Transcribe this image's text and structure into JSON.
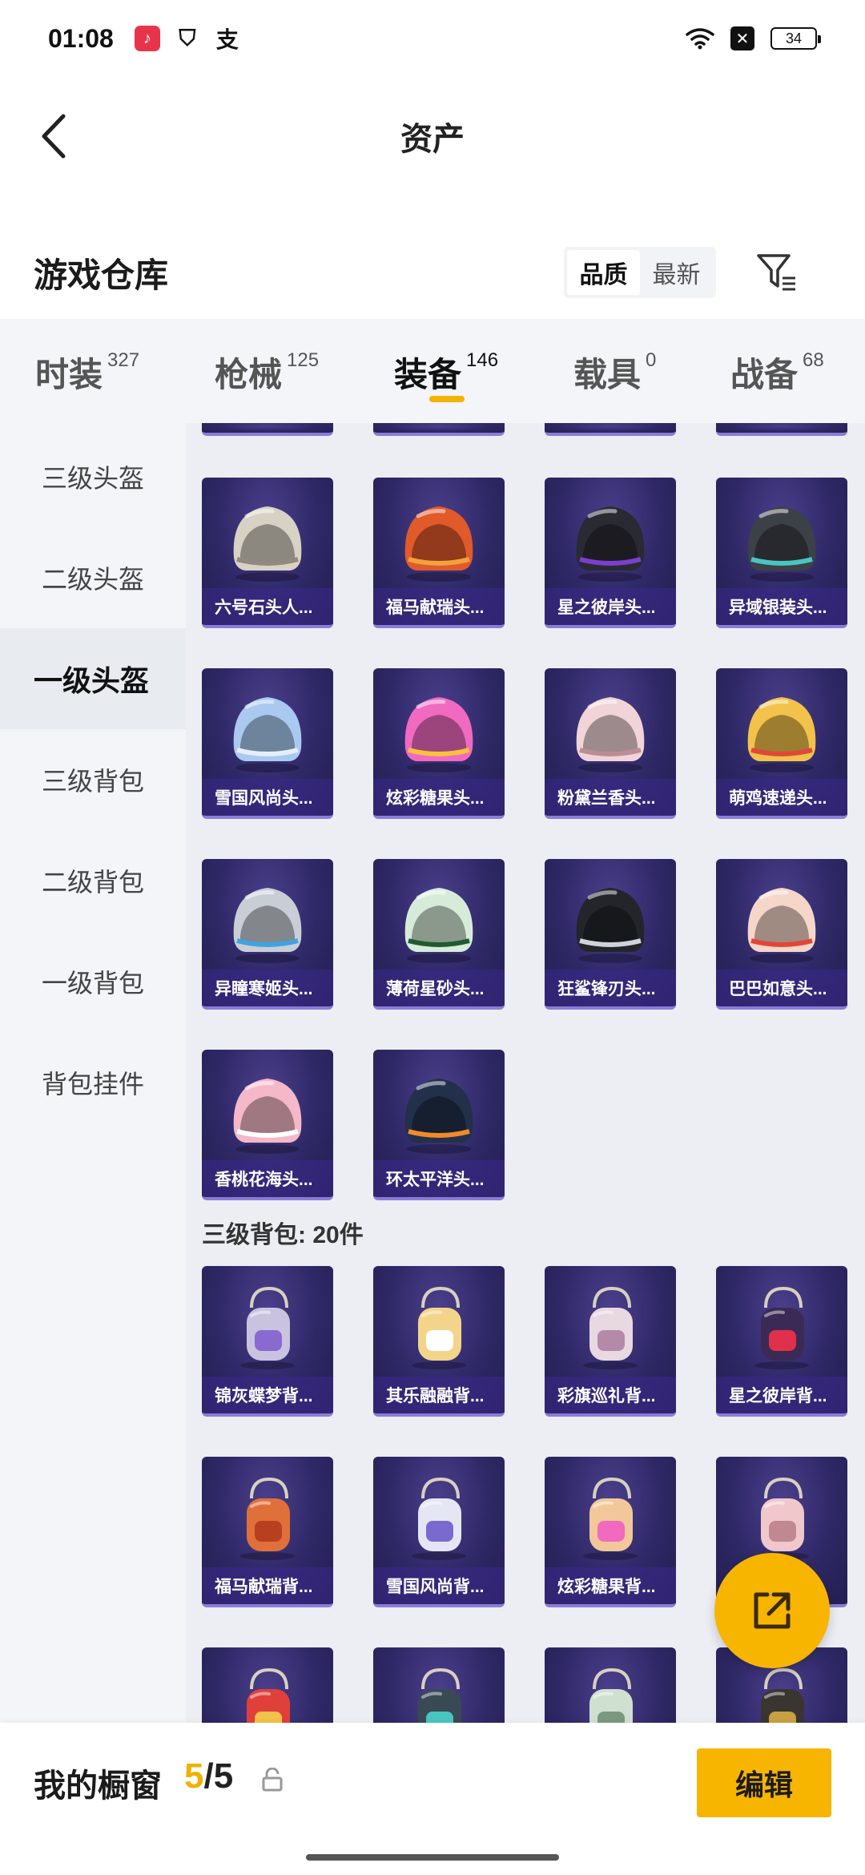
{
  "status_bar": {
    "time": "01:08",
    "battery": "34"
  },
  "header": {
    "title": "资产"
  },
  "section": {
    "title": "游戏仓库",
    "sort_options": [
      "品质",
      "最新"
    ],
    "active_sort": "品质"
  },
  "tabs": [
    {
      "label": "时装",
      "count": "327"
    },
    {
      "label": "枪械",
      "count": "125"
    },
    {
      "label": "装备",
      "count": "146",
      "active": true
    },
    {
      "label": "载具",
      "count": "0"
    },
    {
      "label": "战备",
      "count": "68"
    }
  ],
  "sidebar": {
    "items": [
      {
        "label": "三级头盔"
      },
      {
        "label": "二级头盔"
      },
      {
        "label": "一级头盔",
        "active": true
      },
      {
        "label": "三级背包"
      },
      {
        "label": "二级背包"
      },
      {
        "label": "一级背包"
      },
      {
        "label": "背包挂件"
      }
    ]
  },
  "helmets": {
    "items": [
      {
        "name": "六号石头人...",
        "color": "#d8d2c4",
        "trim": "#8f8a7e"
      },
      {
        "name": "福马献瑞头...",
        "color": "#e05a2a",
        "trim": "#f1a23b"
      },
      {
        "name": "星之彼岸头...",
        "color": "#2a2a33",
        "trim": "#7a3fd0"
      },
      {
        "name": "异域银装头...",
        "color": "#3c4047",
        "trim": "#49c5c0"
      },
      {
        "name": "雪国风尚头...",
        "color": "#a9c9f0",
        "trim": "#e6eefb"
      },
      {
        "name": "炫彩糖果头...",
        "color": "#f06ac0",
        "trim": "#f7c23d"
      },
      {
        "name": "粉黛兰香头...",
        "color": "#f1d4d8",
        "trim": "#b98e95"
      },
      {
        "name": "萌鸡速递头...",
        "color": "#f2c24a",
        "trim": "#e0473a"
      },
      {
        "name": "异瞳寒姬头...",
        "color": "#c9ced6",
        "trim": "#3fa3e0"
      },
      {
        "name": "薄荷星砂头...",
        "color": "#d6ecd8",
        "trim": "#1f5a33"
      },
      {
        "name": "狂鲨锋刃头...",
        "color": "#23252b",
        "trim": "#cfd3da"
      },
      {
        "name": "巴巴如意头...",
        "color": "#f5d6c8",
        "trim": "#e0473a"
      },
      {
        "name": "香桃花海头...",
        "color": "#f4b8c8",
        "trim": "#ffffff"
      },
      {
        "name": "环太平洋头...",
        "color": "#23304a",
        "trim": "#f08a2a"
      }
    ]
  },
  "backpacks": {
    "title": "三级背包: 20件",
    "items": [
      {
        "name": "锦灰蝶梦背...",
        "color": "#c9c3e0",
        "trim": "#8a6ad0"
      },
      {
        "name": "其乐融融背...",
        "color": "#f2d58a",
        "trim": "#ffffff"
      },
      {
        "name": "彩旗巡礼背...",
        "color": "#e8d8e0",
        "trim": "#b48aa8"
      },
      {
        "name": "星之彼岸背...",
        "color": "#3a2a55",
        "trim": "#e0304a"
      },
      {
        "name": "福马献瑞背...",
        "color": "#e0703a",
        "trim": "#b84020"
      },
      {
        "name": "雪国风尚背...",
        "color": "#e4e6f4",
        "trim": "#7a6ad0"
      },
      {
        "name": "炫彩糖果背...",
        "color": "#f2c89a",
        "trim": "#f06ac0"
      },
      {
        "name": "",
        "color": "#f0c8cc",
        "trim": "#c08890"
      },
      {
        "name": "",
        "color": "#e0403a",
        "trim": "#f2c24a"
      },
      {
        "name": "",
        "color": "#3a4a55",
        "trim": "#49c5c0"
      },
      {
        "name": "",
        "color": "#cfe0d0",
        "trim": "#7a9a80"
      },
      {
        "name": "",
        "color": "#3a3530",
        "trim": "#c8a040"
      }
    ]
  },
  "bottom_bar": {
    "window_label": "我的橱窗",
    "count_current": "5",
    "count_sep": "/",
    "count_max": "5",
    "edit_label": "编辑"
  },
  "colors": {
    "accent": "#f7b500",
    "card_bg": "#2e2866"
  }
}
